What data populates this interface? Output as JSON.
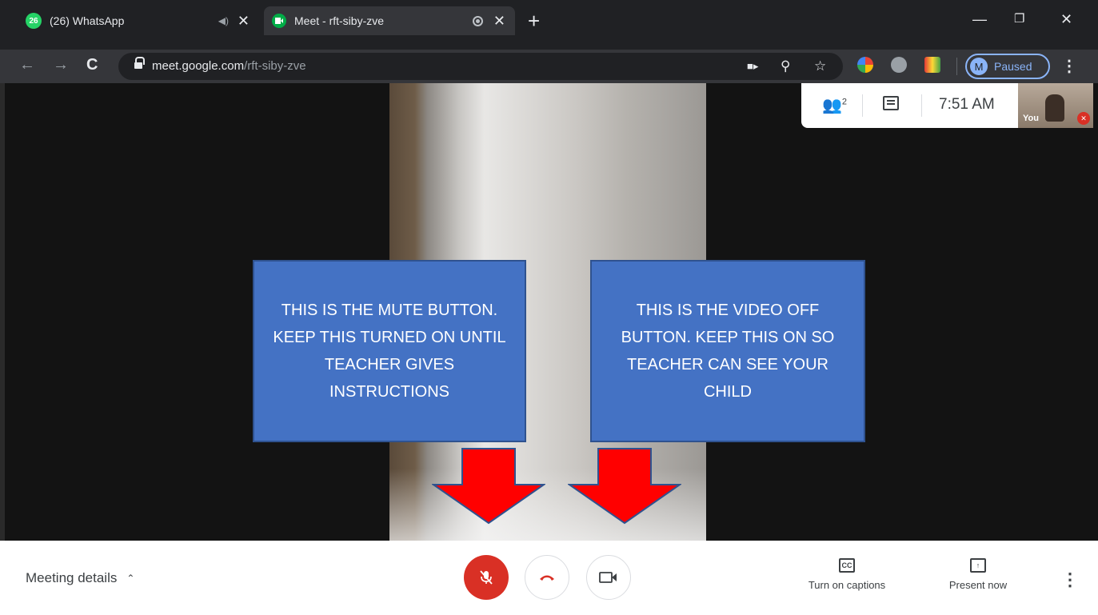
{
  "tabs": [
    {
      "badge": "26",
      "title": "(26) WhatsApp",
      "icon": "whatsapp-icon",
      "state": "inactive"
    },
    {
      "title": "Meet - rft-siby-zve",
      "icon": "google-meet-icon",
      "state": "active"
    }
  ],
  "address_bar": {
    "host": "meet.google.com",
    "path": "/rft-siby-zve"
  },
  "profile": {
    "initial": "M",
    "status": "Paused"
  },
  "meeting_info": {
    "participant_count": "2",
    "time": "7:51 AM",
    "self_label": "You"
  },
  "callouts": {
    "mute_text": "THIS IS THE MUTE BUTTON. KEEP THIS TURNED ON UNTIL TEACHER GIVES INSTRUCTIONS",
    "video_text": "THIS IS THE VIDEO OFF BUTTON. KEEP THIS ON SO TEACHER CAN SEE YOUR CHILD"
  },
  "controls": {
    "meeting_details": "Meeting details",
    "captions_icon_text": "CC",
    "captions_label": "Turn on captions",
    "present_label": "Present now"
  },
  "colors": {
    "callout_fill": "#4472c4",
    "arrow_fill": "#ff0000",
    "mic_off_red": "#d93025",
    "profile_accent": "#8ab4f8"
  }
}
